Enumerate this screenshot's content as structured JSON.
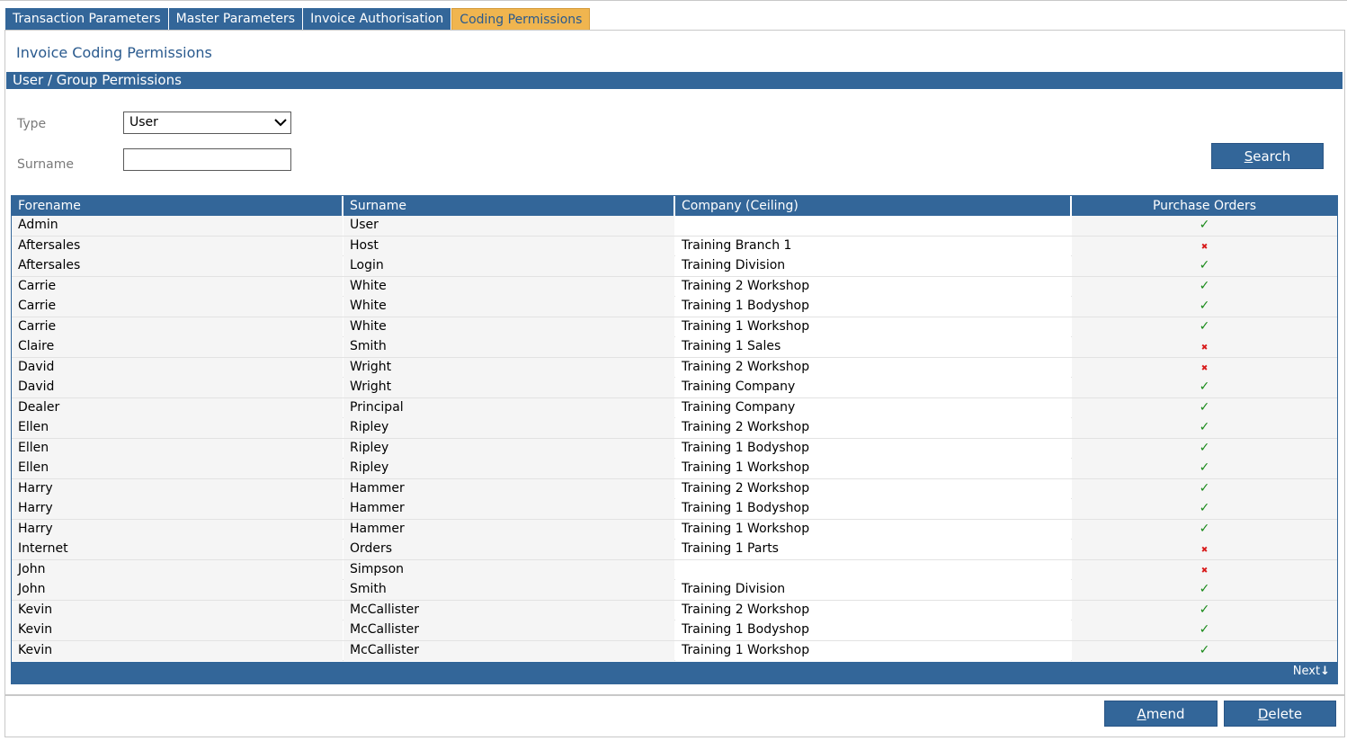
{
  "tabs": [
    {
      "label": "Transaction Parameters",
      "active": false
    },
    {
      "label": "Master Parameters",
      "active": false
    },
    {
      "label": "Invoice Authorisation",
      "active": false
    },
    {
      "label": "Coding Permissions",
      "active": true
    }
  ],
  "page_title": "Invoice Coding Permissions",
  "section_title": "User / Group Permissions",
  "filters": {
    "type_label": "Type",
    "type_value": "User",
    "surname_label": "Surname",
    "surname_value": ""
  },
  "buttons": {
    "search_key": "S",
    "search_rest": "earch",
    "amend_key": "A",
    "amend_rest": "mend",
    "delete_key": "D",
    "delete_rest": "elete"
  },
  "table": {
    "columns": [
      "Forename",
      "Surname",
      "Company (Ceiling)",
      "Purchase Orders"
    ],
    "rows": [
      {
        "forename": "Admin",
        "surname": "User",
        "company": "",
        "po": true
      },
      {
        "forename": "Aftersales",
        "surname": "Host",
        "company": "Training Branch 1",
        "po": false
      },
      {
        "forename": "Aftersales",
        "surname": "Login",
        "company": "Training Division",
        "po": true
      },
      {
        "forename": "Carrie",
        "surname": "White",
        "company": "Training 2 Workshop",
        "po": true
      },
      {
        "forename": "Carrie",
        "surname": "White",
        "company": "Training 1 Bodyshop",
        "po": true
      },
      {
        "forename": "Carrie",
        "surname": "White",
        "company": "Training 1 Workshop",
        "po": true
      },
      {
        "forename": "Claire",
        "surname": "Smith",
        "company": "Training 1 Sales",
        "po": false
      },
      {
        "forename": "David",
        "surname": "Wright",
        "company": "Training 2 Workshop",
        "po": false
      },
      {
        "forename": "David",
        "surname": "Wright",
        "company": "Training Company",
        "po": true
      },
      {
        "forename": "Dealer",
        "surname": "Principal",
        "company": "Training Company",
        "po": true
      },
      {
        "forename": "Ellen",
        "surname": "Ripley",
        "company": "Training 2 Workshop",
        "po": true
      },
      {
        "forename": "Ellen",
        "surname": "Ripley",
        "company": "Training 1 Bodyshop",
        "po": true
      },
      {
        "forename": "Ellen",
        "surname": "Ripley",
        "company": "Training 1 Workshop",
        "po": true
      },
      {
        "forename": "Harry",
        "surname": "Hammer",
        "company": "Training 2 Workshop",
        "po": true
      },
      {
        "forename": "Harry",
        "surname": "Hammer",
        "company": "Training 1 Bodyshop",
        "po": true
      },
      {
        "forename": "Harry",
        "surname": "Hammer",
        "company": "Training 1 Workshop",
        "po": true
      },
      {
        "forename": "Internet",
        "surname": "Orders",
        "company": "Training 1 Parts",
        "po": false
      },
      {
        "forename": "John",
        "surname": "Simpson",
        "company": "",
        "po": false
      },
      {
        "forename": "John",
        "surname": "Smith",
        "company": "Training Division",
        "po": true
      },
      {
        "forename": "Kevin",
        "surname": "McCallister",
        "company": "Training 2 Workshop",
        "po": true
      },
      {
        "forename": "Kevin",
        "surname": "McCallister",
        "company": "Training 1 Bodyshop",
        "po": true
      },
      {
        "forename": "Kevin",
        "surname": "McCallister",
        "company": "Training 1 Workshop",
        "po": true
      }
    ],
    "next_label": "Next"
  },
  "icons": {
    "yes": "check-icon",
    "no": "cross-icon",
    "next": "arrow-down-icon"
  },
  "colors": {
    "primary": "#336699",
    "active_tab": "#f0b54f",
    "check": "#1a8a1a",
    "cross": "#d81b1b"
  }
}
